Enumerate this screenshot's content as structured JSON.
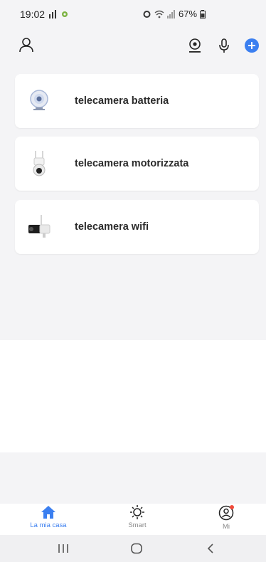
{
  "status_bar": {
    "time": "19:02",
    "battery": "67%"
  },
  "header": {
    "profile_icon": "person-outline-icon",
    "camera_icon": "camera-icon",
    "mic_icon": "microphone-icon",
    "add_icon": "plus-circle-icon",
    "accent": "#3b7ff0"
  },
  "devices": [
    {
      "label": "telecamera batteria",
      "icon": "battery-camera-icon"
    },
    {
      "label": "telecamera motorizzata",
      "icon": "motorized-camera-icon"
    },
    {
      "label": "telecamera wifi",
      "icon": "wifi-camera-icon"
    }
  ],
  "tabs": [
    {
      "label": "La mia casa",
      "icon": "home-icon",
      "active": true
    },
    {
      "label": "Smart",
      "icon": "sun-icon",
      "active": false
    },
    {
      "label": "Mi",
      "icon": "user-circle-icon",
      "active": false
    }
  ],
  "colors": {
    "background_gray": "#f4f4f6",
    "notification_dot": "#f04a3a"
  }
}
